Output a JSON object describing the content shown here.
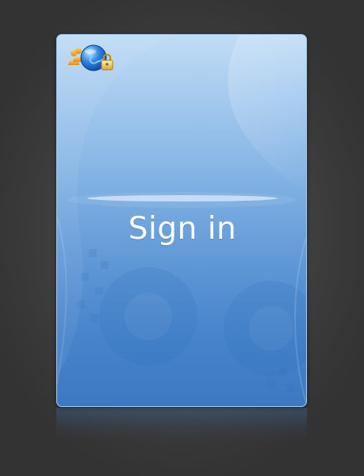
{
  "window": {
    "heading": "Sign in"
  },
  "logo": {
    "icon": "globe-lock-users-icon"
  },
  "colors": {
    "background": "#3f3f3f",
    "card_top": "#c0dcf5",
    "card_bottom": "#3d79c3",
    "text": "#ffffff"
  }
}
